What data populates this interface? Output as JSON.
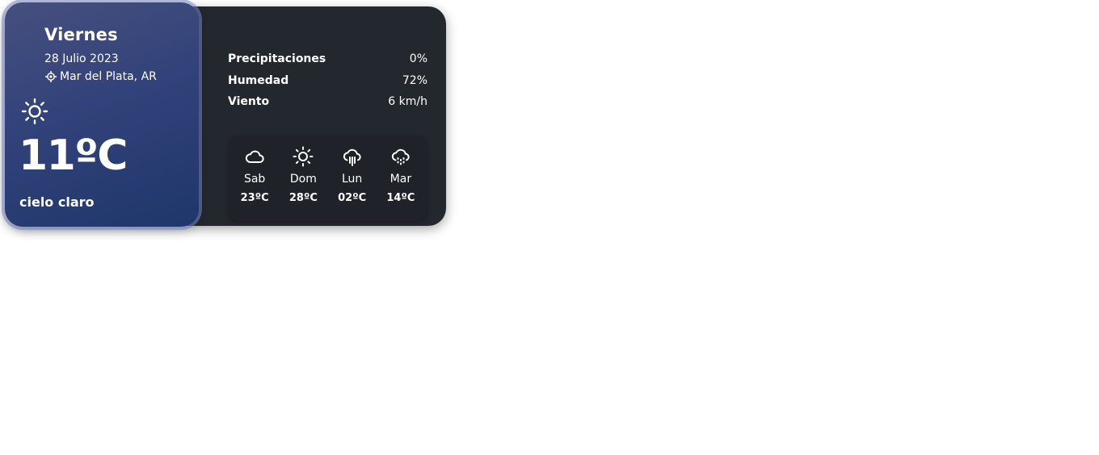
{
  "today": {
    "day": "Viernes",
    "date": "28 Julio 2023",
    "location": "Mar del Plata, AR",
    "location_icon": "location-crosshair-icon",
    "icon": "sun-icon",
    "temperature": "11ºC",
    "description": "cielo claro",
    "gradient_colors": [
      "#46507e",
      "#1e376b"
    ]
  },
  "stats": [
    {
      "label": "Precipitaciones",
      "value": "0%"
    },
    {
      "label": "Humedad",
      "value": "72%"
    },
    {
      "label": "Viento",
      "value": "6 km/h"
    }
  ],
  "forecast": [
    {
      "day": "Sab",
      "temp": "23ºC",
      "icon": "cloud-icon"
    },
    {
      "day": "Dom",
      "temp": "28ºC",
      "icon": "sun-icon"
    },
    {
      "day": "Lun",
      "temp": "02ºC",
      "icon": "cloud-rain-icon"
    },
    {
      "day": "Mar",
      "temp": "14ºC",
      "icon": "cloud-drizzle-icon"
    }
  ],
  "colors": {
    "card_background": "#23272e",
    "forecast_background": "#1f2329",
    "text": "#ffffff"
  }
}
